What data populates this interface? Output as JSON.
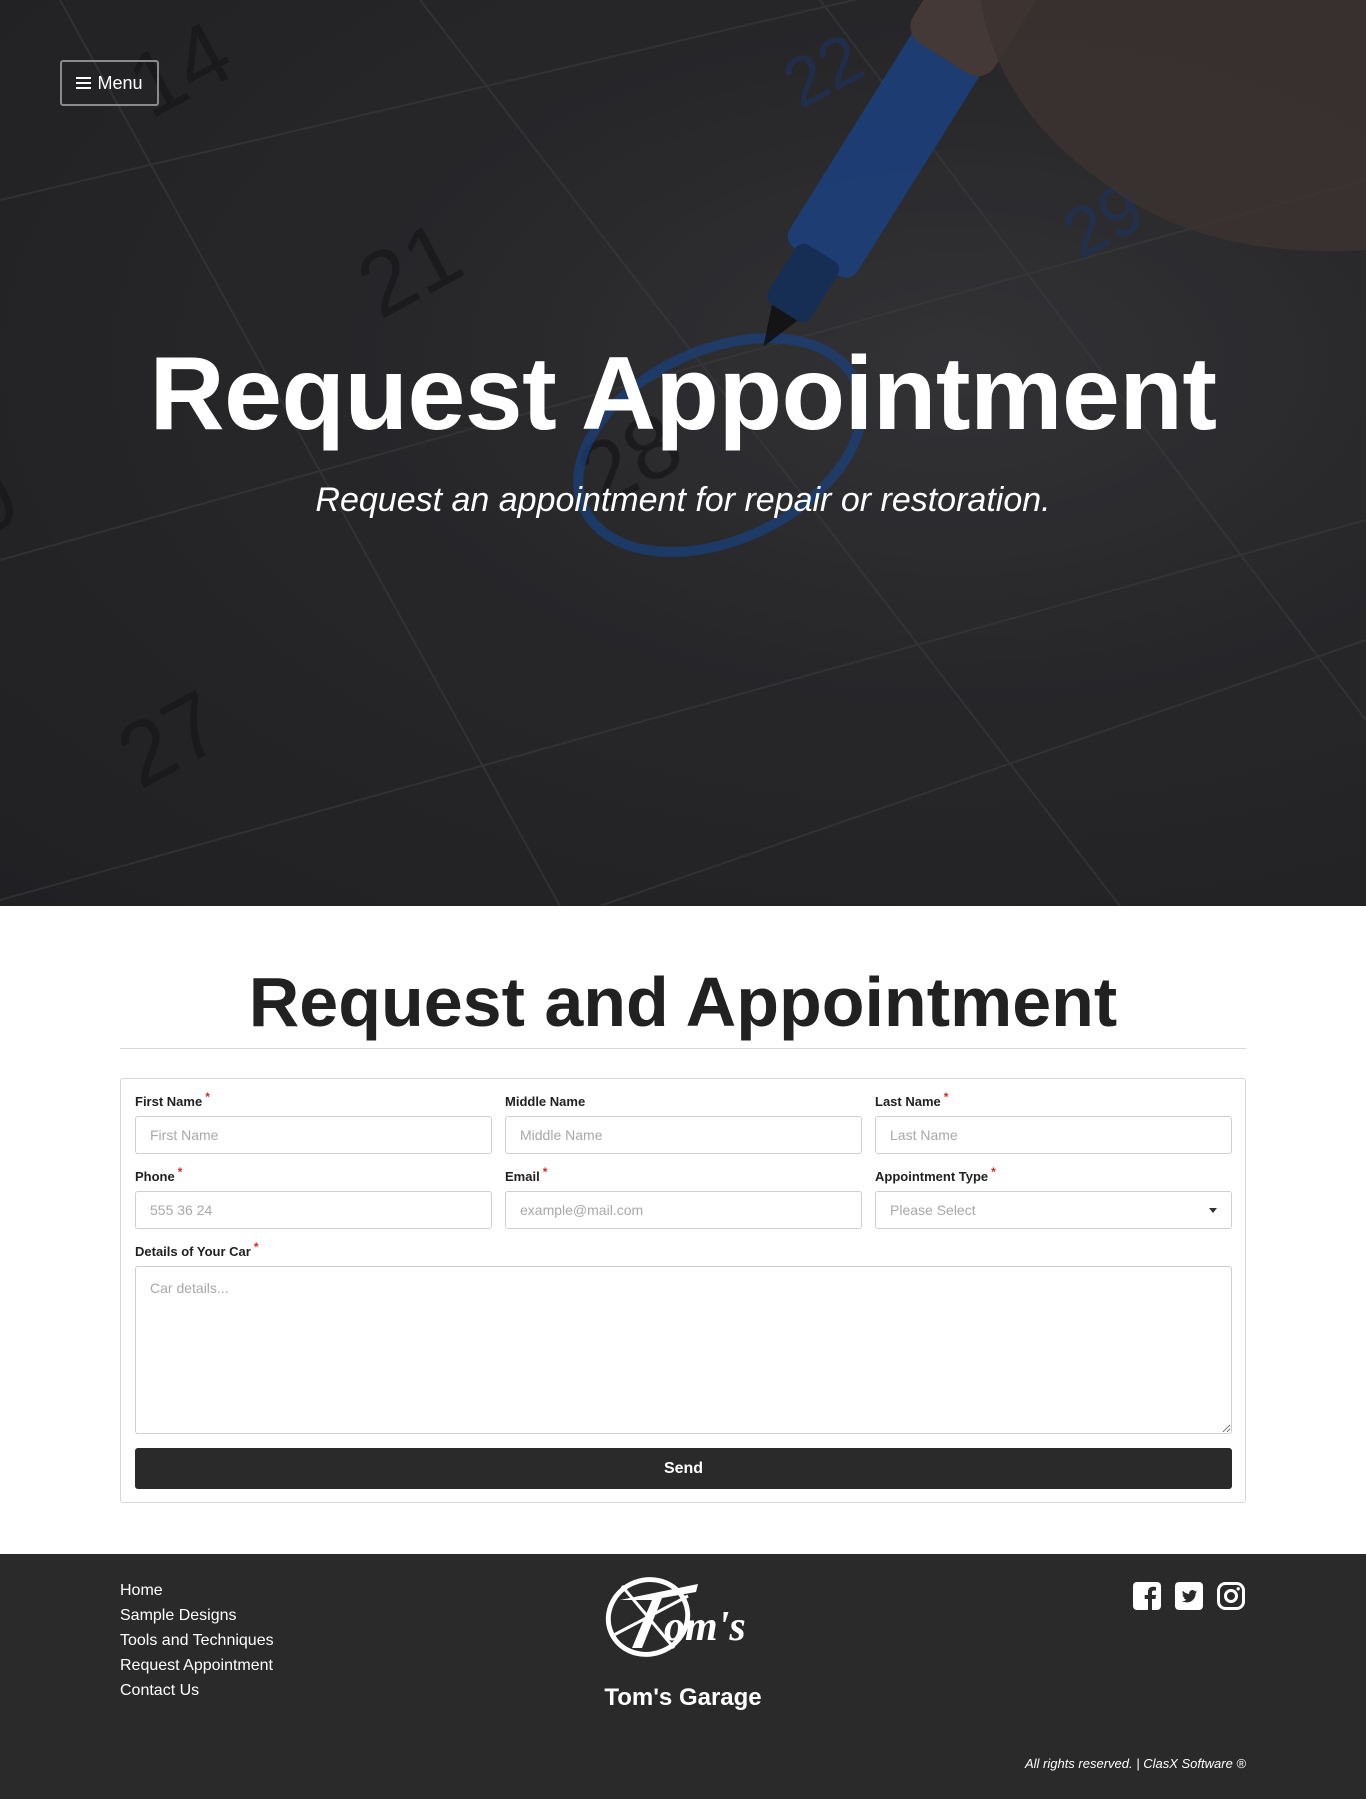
{
  "nav": {
    "menu_label": "Menu",
    "menu_icon": "hamburger-icon"
  },
  "hero": {
    "title": "Request Appointment",
    "subtitle": "Request an appointment for repair or restoration."
  },
  "form": {
    "title": "Request and Appointment",
    "first_name": {
      "label": "First Name",
      "placeholder": "First Name",
      "required": "*"
    },
    "middle_name": {
      "label": "Middle Name",
      "placeholder": "Middle Name"
    },
    "last_name": {
      "label": "Last Name",
      "placeholder": "Last Name",
      "required": "*"
    },
    "phone": {
      "label": "Phone",
      "placeholder": "555 36 24",
      "required": "*"
    },
    "email": {
      "label": "Email",
      "placeholder": "example@mail.com",
      "required": "*"
    },
    "appointment_type": {
      "label": "Appointment Type",
      "selected": "Please Select",
      "required": "*"
    },
    "car_details": {
      "label": "Details of Your Car",
      "placeholder": "Car details...",
      "required": "*"
    },
    "send_label": "Send"
  },
  "footer": {
    "links": [
      "Home",
      "Sample Designs",
      "Tools and Techniques",
      "Request Appointment",
      "Contact Us"
    ],
    "logo_text": "Tom's",
    "brand": "Tom's Garage",
    "socials": [
      "facebook-icon",
      "twitter-icon",
      "instagram-icon"
    ],
    "copyright": "All rights reserved. | ClasX Software ®"
  },
  "colors": {
    "hero_bg": "#2e2e30",
    "footer_bg": "#2a2a2b",
    "button_bg": "#2a2a2b",
    "required": "#e02424",
    "calendar_ink": "#1a4fa0"
  }
}
